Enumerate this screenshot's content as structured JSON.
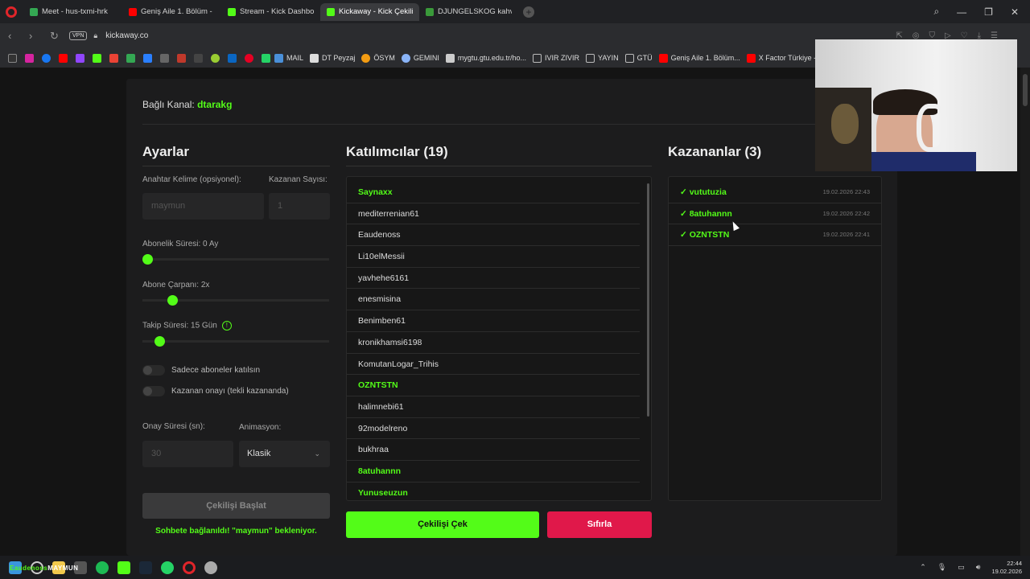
{
  "browser": {
    "tabs": [
      {
        "label": "Meet - hus-txmi-hrk",
        "color": "#34a853"
      },
      {
        "label": "Geniş Aile 1. Bölüm - Full",
        "color": "#ff0000"
      },
      {
        "label": "Stream - Kick Dashboard",
        "color": "#53fc18"
      },
      {
        "label": "Kickaway - Kick Çekiliş Ar",
        "color": "#53fc18"
      },
      {
        "label": "DJUNGELSKOG kahvereng",
        "color": "#3a9a3a"
      }
    ],
    "url": "kickaway.co",
    "vpn": "VPN",
    "bookmarks": [
      {
        "label": "MAIL"
      },
      {
        "label": "DT Peyzaj"
      },
      {
        "label": "ÖSYM"
      },
      {
        "label": "GEMINI"
      },
      {
        "label": "mygtu.gtu.edu.tr/ho..."
      },
      {
        "label": "IVIR ZIVIR"
      },
      {
        "label": "YAYIN"
      },
      {
        "label": "GTÜ"
      },
      {
        "label": "Geniş Aile 1. Bölüm..."
      },
      {
        "label": "X Factor Türkiye - Y..."
      }
    ]
  },
  "page": {
    "connected_label": "Bağlı Kanal:",
    "connected_channel": "dtarakg",
    "settings": {
      "title": "Ayarlar",
      "keyword_label": "Anahtar Kelime (opsiyonel):",
      "keyword_placeholder": "maymun",
      "winner_count_label": "Kazanan Sayısı:",
      "winner_count_placeholder": "1",
      "sub_duration_label": "Abonelik Süresi: 0 Ay",
      "sub_duration_value": 0,
      "sub_multiplier_label": "Abone Çarpanı: 2x",
      "sub_multiplier_value": 0.14,
      "follow_duration_label": "Takip Süresi: 15 Gün",
      "follow_duration_value": 0.07,
      "subs_only_label": "Sadece aboneler katılsın",
      "winner_confirm_label": "Kazanan onayı (tekli kazananda)",
      "confirm_time_label": "Onay Süresi (sn):",
      "confirm_time_placeholder": "30",
      "animation_label": "Animasyon:",
      "animation_value": "Klasik",
      "start_button": "Çekilişi Başlat",
      "status": "Sohbete bağlanıldı! \"maymun\" bekleniyor."
    },
    "participants": {
      "title": "Katılımcılar (19)",
      "items": [
        {
          "name": "Saynaxx",
          "winner": true
        },
        {
          "name": "mediterrenian61",
          "winner": false
        },
        {
          "name": "Eaudenoss",
          "winner": false
        },
        {
          "name": "Li10elMessii",
          "winner": false
        },
        {
          "name": "yavhehe6161",
          "winner": false
        },
        {
          "name": "enesmisina",
          "winner": false
        },
        {
          "name": "Benimben61",
          "winner": false
        },
        {
          "name": "kronikhamsi6198",
          "winner": false
        },
        {
          "name": "KomutanLogar_Trihis",
          "winner": false
        },
        {
          "name": "OZNTSTN",
          "winner": true
        },
        {
          "name": "halimnebi61",
          "winner": false
        },
        {
          "name": "92modelreno",
          "winner": false
        },
        {
          "name": "bukhraa",
          "winner": false
        },
        {
          "name": "8atuhannn",
          "winner": true
        },
        {
          "name": "Yunuseuzun",
          "winner": true
        }
      ]
    },
    "winners": {
      "title": "Kazananlar (3)",
      "items": [
        {
          "name": "✓ vututuzia",
          "time": "19.02.2026 22:43"
        },
        {
          "name": "✓ 8atuhannn",
          "time": "19.02.2026 22:42"
        },
        {
          "name": "✓ OZNTSTN",
          "time": "19.02.2026 22:41"
        }
      ]
    },
    "draw_button": "Çekilişi Çek",
    "reset_button": "Sıfırla"
  },
  "taskbar": {
    "overlay_prefix": "Eaudenoss",
    "overlay_word": "MAYMUN",
    "time": "22:44",
    "date": "19.02.2026"
  },
  "colors": {
    "accent": "#53fc18",
    "danger": "#e0184a"
  }
}
